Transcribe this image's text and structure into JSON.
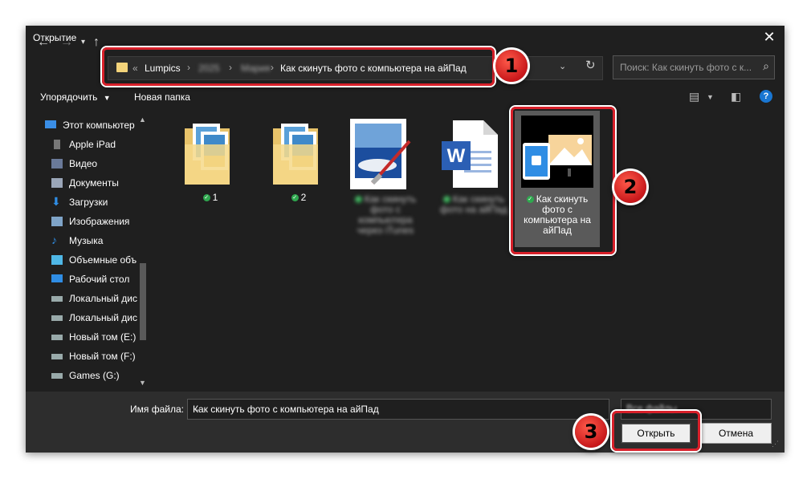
{
  "window": {
    "title": "Открытие",
    "close_icon": "close-icon"
  },
  "address_bar": {
    "prefix": "«",
    "segments": [
      "Lumpics",
      "2025",
      "Мария",
      "Как скинуть фото с компьютера на айПад"
    ],
    "separators": [
      "›",
      "›",
      "›"
    ]
  },
  "search": {
    "placeholder": "Поиск: Как скинуть фото с к..."
  },
  "toolbar": {
    "organize_label": "Упорядочить",
    "new_folder_label": "Новая папка"
  },
  "sidebar": {
    "items": [
      {
        "label": "Этот компьютер",
        "icon": "computer-icon"
      },
      {
        "label": "Apple iPad",
        "icon": "ipad-icon"
      },
      {
        "label": "Видео",
        "icon": "video-icon"
      },
      {
        "label": "Документы",
        "icon": "documents-icon"
      },
      {
        "label": "Загрузки",
        "icon": "download-icon"
      },
      {
        "label": "Изображения",
        "icon": "pictures-icon"
      },
      {
        "label": "Музыка",
        "icon": "music-icon"
      },
      {
        "label": "Объемные объ",
        "icon": "3d-objects-icon"
      },
      {
        "label": "Рабочий стол",
        "icon": "desktop-icon"
      },
      {
        "label": "Локальный дис",
        "icon": "drive-icon"
      },
      {
        "label": "Локальный дис",
        "icon": "drive-icon"
      },
      {
        "label": "Новый том (E:)",
        "icon": "drive-icon"
      },
      {
        "label": "Новый том (F:)",
        "icon": "drive-icon"
      },
      {
        "label": "Games (G:)",
        "icon": "drive-icon"
      }
    ]
  },
  "files": [
    {
      "name": "1",
      "type": "folder",
      "synced": true
    },
    {
      "name": "2",
      "type": "folder",
      "synced": true
    },
    {
      "name": "Как скинуть фото с компьютера через iTunes",
      "type": "image",
      "synced": true,
      "obscured": true
    },
    {
      "name": "Как скинуть фото на айПад",
      "type": "word",
      "synced": true,
      "obscured": true
    },
    {
      "name": "Как скинуть фото с компьютера на айПад",
      "type": "image",
      "synced": true,
      "selected": true
    }
  ],
  "footer": {
    "filename_label": "Имя файла:",
    "filename_value": "Как скинуть фото с компьютера на айПад",
    "filetype_value": "Все файлы",
    "open_label": "Открыть",
    "cancel_label": "Отмена"
  },
  "callouts": [
    "1",
    "2",
    "3"
  ],
  "colors": {
    "highlight": "#d8202a",
    "dialog_bg": "#1f1f1f",
    "accent": "#1976d2"
  }
}
